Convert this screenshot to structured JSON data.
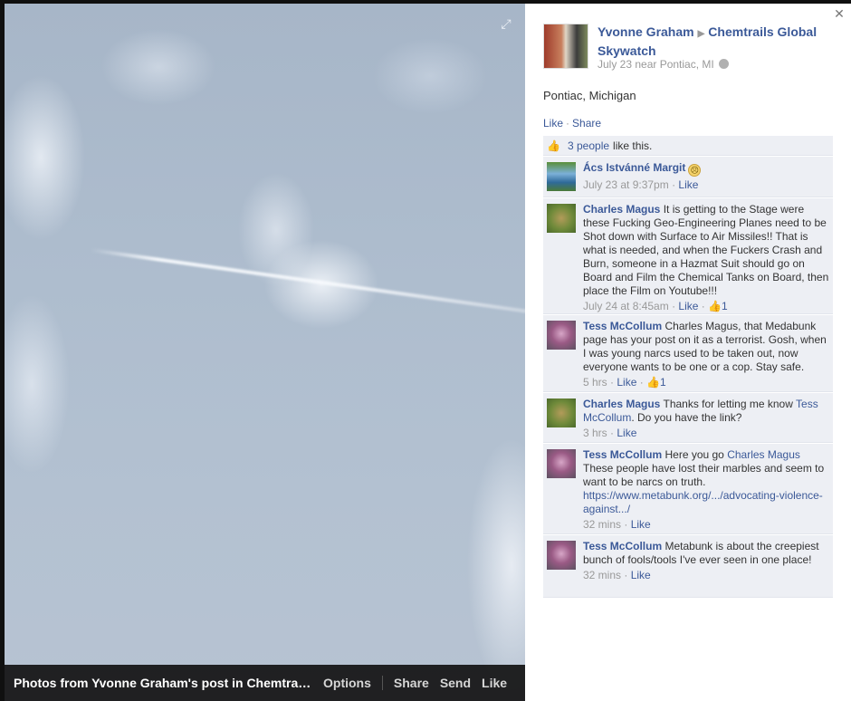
{
  "photo": {
    "caption": "Photos from Yvonne Graham's post in Chemtrails ...",
    "options_label": "Options",
    "share_label": "Share",
    "send_label": "Send",
    "like_label": "Like"
  },
  "post": {
    "author": "Yvonne Graham",
    "group": "Chemtrails Global Skywatch",
    "meta": "July 23 near Pontiac, MI",
    "text": "Pontiac, Michigan",
    "like_label": "Like",
    "share_label": "Share",
    "likes_count_text": "3 people",
    "likes_suffix": "like this."
  },
  "comments": [
    {
      "name": "Ács Istvánné Margit",
      "mention": "",
      "text": "",
      "time": "July 23 at 9:37pm",
      "like": "Like",
      "likes": ""
    },
    {
      "name": "Charles Magus",
      "mention": "",
      "text": "It is getting to the Stage were these Fucking Geo-Engineering Planes need to be Shot down with Surface to Air Missiles!! That is what is needed, and when the Fuckers Crash and Burn, someone in a Hazmat Suit should go on Board and Film the Chemical Tanks on Board, then place the Film on Youtube!!!",
      "time": "July 24 at 8:45am",
      "like": "Like",
      "likes": "1"
    },
    {
      "name": "Tess McCollum",
      "mention": "",
      "text": "Charles Magus, that Medabunk page has your post on it as a terrorist. Gosh, when I was young narcs used to be taken out, now everyone wants to be one or a cop. Stay safe.",
      "time": "5 hrs",
      "like": "Like",
      "likes": "1"
    },
    {
      "name": "Charles Magus",
      "mention": "",
      "text": "Thanks for letting me know",
      "mention2": "Tess McCollum",
      "text2": ". Do you have the link?",
      "time": "3 hrs",
      "like": "Like",
      "likes": ""
    },
    {
      "name": "Tess McCollum",
      "mention": "",
      "text": "Here you go",
      "mention2": "Charles Magus",
      "text2": " These people have lost their marbles and seem to want to be narcs on truth.",
      "link": "https://www.metabunk.org/.../advocating-violence-against.../",
      "time": "32 mins",
      "like": "Like",
      "likes": ""
    },
    {
      "name": "Tess McCollum",
      "mention": "",
      "text": "Metabunk is about the creepiest bunch of fools/tools I've ever seen in one place!",
      "time": "32 mins",
      "like": "Like",
      "likes": ""
    }
  ]
}
